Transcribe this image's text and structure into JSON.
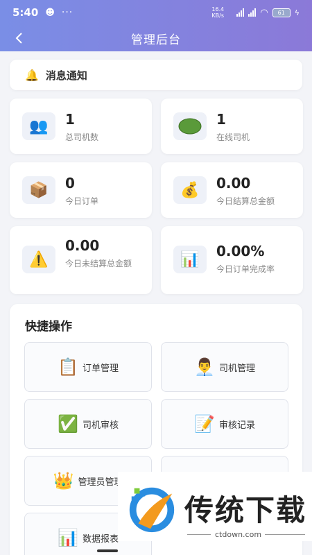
{
  "status_bar": {
    "time": "5:40",
    "dots": "···",
    "net_speed": "16.4 KB/s",
    "battery": "61"
  },
  "header": {
    "title": "管理后台"
  },
  "notice": {
    "label": "消息通知",
    "icon": "bell-icon"
  },
  "stats": [
    {
      "value": "1",
      "label": "总司机数",
      "icon": "users-icon"
    },
    {
      "value": "1",
      "label": "在线司机",
      "icon": "online-dot-icon"
    },
    {
      "value": "0",
      "label": "今日订单",
      "icon": "package-icon"
    },
    {
      "value": "0.00",
      "label": "今日结算总金额",
      "icon": "money-bag-icon"
    },
    {
      "value": "0.00",
      "label": "今日未结算总金额",
      "icon": "warning-icon"
    },
    {
      "value": "0.00%",
      "label": "今日订单完成率",
      "icon": "chart-icon"
    }
  ],
  "quick": {
    "title": "快捷操作",
    "items": [
      {
        "label": "订单管理",
        "icon": "clipboard-icon"
      },
      {
        "label": "司机管理",
        "icon": "driver-icon"
      },
      {
        "label": "司机审核",
        "icon": "check-icon"
      },
      {
        "label": "审核记录",
        "icon": "memo-icon"
      },
      {
        "label": "管理员管理",
        "icon": "crown-icon"
      },
      {
        "label": "",
        "icon": ""
      },
      {
        "label": "数据报表",
        "icon": "bar-chart-icon"
      }
    ]
  },
  "watermark": {
    "brand": "传统下载",
    "url": "ctdown.com"
  },
  "colors": {
    "header_start": "#7a8ee6",
    "header_end": "#8b79d8",
    "background": "#f3f4f8"
  }
}
